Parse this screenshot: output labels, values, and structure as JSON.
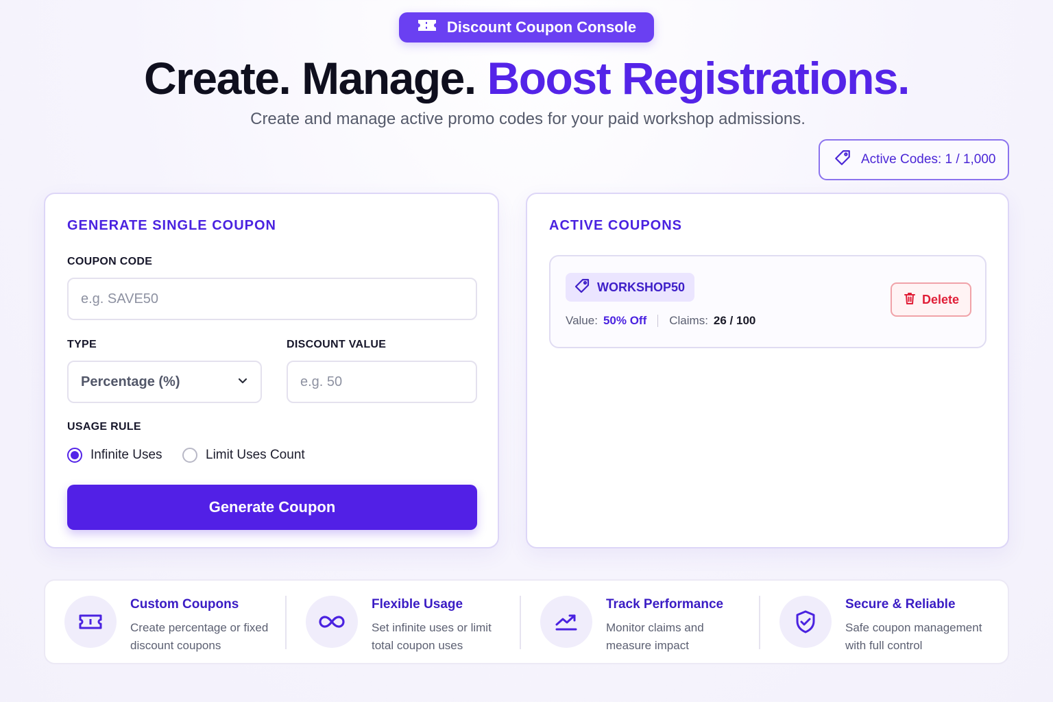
{
  "badge": {
    "label": "Discount Coupon Console",
    "icon": "ticket-icon"
  },
  "headline": {
    "part1": "Create. Manage.",
    "part2": "Boost Registrations."
  },
  "subtitle": "Create and manage active promo codes for your paid workshop admissions.",
  "active_codes": {
    "label": "Active Codes: 1 / 1,000",
    "icon": "tag-icon"
  },
  "generate": {
    "title": "GENERATE SINGLE COUPON",
    "coupon_code_label": "COUPON CODE",
    "coupon_code_placeholder": "e.g. SAVE50",
    "coupon_code_value": "",
    "type_label": "TYPE",
    "type_value": "Percentage (%)",
    "discount_label": "DISCOUNT VALUE",
    "discount_placeholder": "e.g. 50",
    "discount_value": "",
    "usage_label": "USAGE RULE",
    "usage_options": [
      "Infinite Uses",
      "Limit Uses Count"
    ],
    "usage_selected": "Infinite Uses",
    "button": "Generate Coupon"
  },
  "active": {
    "title": "ACTIVE COUPONS",
    "coupons": [
      {
        "code": "WORKSHOP50",
        "value_label": "Value:",
        "value": "50% Off",
        "claims_label": "Claims:",
        "claims": "26 / 100",
        "delete_label": "Delete"
      }
    ]
  },
  "features": [
    {
      "icon": "ticket-icon",
      "title": "Custom Coupons",
      "desc": "Create percentage or fixed discount coupons"
    },
    {
      "icon": "infinity-icon",
      "title": "Flexible Usage",
      "desc": "Set infinite uses or limit total coupon uses"
    },
    {
      "icon": "chart-up-icon",
      "title": "Track Performance",
      "desc": "Monitor claims and measure impact"
    },
    {
      "icon": "shield-check-icon",
      "title": "Secure & Reliable",
      "desc": "Safe coupon management with full control"
    }
  ],
  "colors": {
    "accent": "#5424e8",
    "badge": "#6a40f2",
    "danger": "#e01e37"
  }
}
